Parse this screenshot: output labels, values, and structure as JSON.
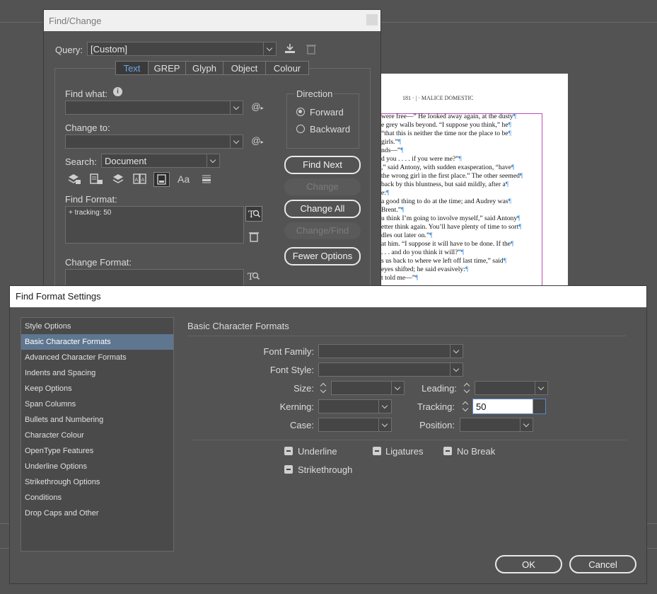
{
  "find_change": {
    "title": "Find/Change",
    "query_label": "Query:",
    "query_value": "[Custom]",
    "tabs": [
      "Text",
      "GREP",
      "Glyph",
      "Object",
      "Colour"
    ],
    "active_tab": "Text",
    "find_what_label": "Find what:",
    "change_to_label": "Change to:",
    "search_label": "Search:",
    "search_value": "Document",
    "direction_label": "Direction",
    "direction_forward": "Forward",
    "direction_backward": "Backward",
    "find_format_label": "Find Format:",
    "find_format_value": "+ tracking: 50",
    "change_format_label": "Change Format:",
    "buttons": {
      "find_next": "Find Next",
      "change": "Change",
      "change_all": "Change All",
      "change_find": "Change/Find",
      "fewer_options": "Fewer Options"
    },
    "option_icons": [
      "locked-layers-icon",
      "locked-stories-icon",
      "hidden-layers-icon",
      "master-pages-icon",
      "footnotes-icon",
      "case-sensitive-icon",
      "whole-word-icon"
    ],
    "case_icon_text": "Aa"
  },
  "document": {
    "header": "181 · | · MALICE DOMESTIC",
    "lines": [
      "were free—” He looked away again, at the dusty",
      "e grey walls beyond. “I suppose you think,” he",
      "“that this is neither the time nor the place to be",
      "girls.”",
      "nds—”",
      "d you . . . . if you were me?”",
      ",” said Antony, with sudden exasperation, “have",
      "the wrong girl in the first place.” The other seemed",
      "back by this bluntness, but said mildly, after a",
      "e:",
      "a good thing to do at the time; and Audrey was",
      "Brent.”",
      "u think I’m going to involve myself,” said Antony",
      "etter think again. You’ll have plenty of time to sort",
      "dles out later on.”",
      "at him. “I suppose it will have to be done. If the",
      ". . . and do you think it will?”",
      "s us back to where we left off last time,” said",
      "eyes shifted; he said evasively:",
      "t told me—”"
    ]
  },
  "find_format_settings": {
    "title": "Find Format Settings",
    "categories": [
      "Style Options",
      "Basic Character Formats",
      "Advanced Character Formats",
      "Indents and Spacing",
      "Keep Options",
      "Span Columns",
      "Bullets and Numbering",
      "Character Colour",
      "OpenType Features",
      "Underline Options",
      "Strikethrough Options",
      "Conditions",
      "Drop Caps and Other"
    ],
    "selected_category": "Basic Character Formats",
    "section_title": "Basic Character Formats",
    "fields": {
      "font_family": "Font Family:",
      "font_style": "Font Style:",
      "size": "Size:",
      "leading": "Leading:",
      "kerning": "Kerning:",
      "tracking": "Tracking:",
      "tracking_value": "50",
      "case": "Case:",
      "position": "Position:"
    },
    "checkboxes": {
      "underline": "Underline",
      "ligatures": "Ligatures",
      "no_break": "No Break",
      "strikethrough": "Strikethrough"
    },
    "ok": "OK",
    "cancel": "Cancel"
  }
}
